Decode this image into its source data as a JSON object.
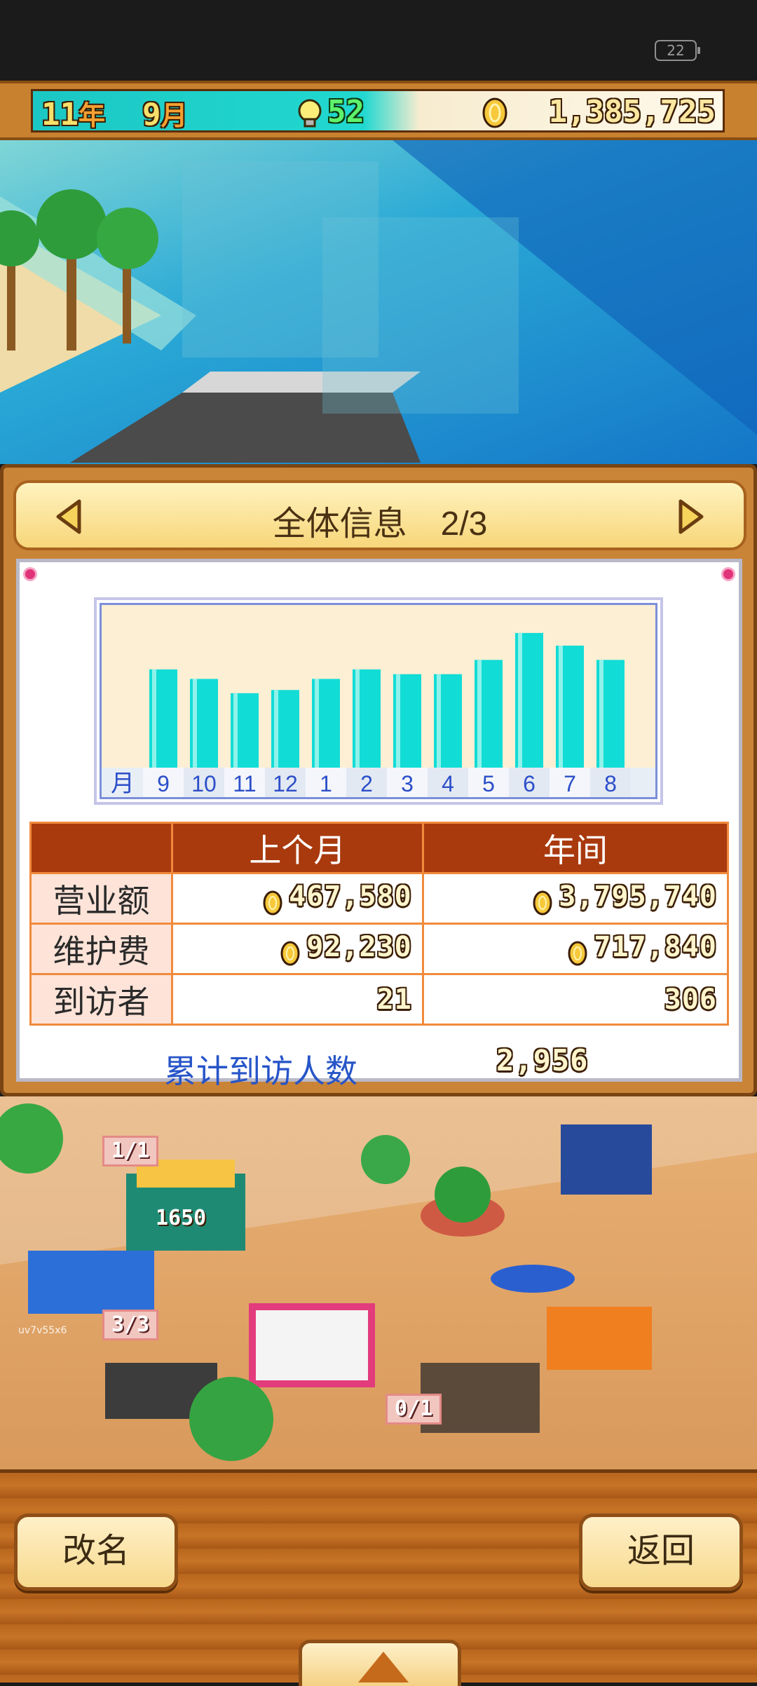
{
  "status_bar": {
    "battery": "22"
  },
  "top_bar": {
    "year": "11",
    "year_unit": "年",
    "month": "9",
    "month_unit": "月",
    "ideas": "52",
    "money": "1,385,725"
  },
  "panel": {
    "title": "全体信息　2/3",
    "chart_data": {
      "type": "bar",
      "x_unit_label": "月",
      "categories": [
        "9",
        "10",
        "11",
        "12",
        "1",
        "2",
        "3",
        "4",
        "5",
        "6",
        "7",
        "8"
      ],
      "values": [
        62,
        56,
        47,
        49,
        56,
        62,
        59,
        59,
        68,
        85,
        77,
        68
      ],
      "ylim": [
        0,
        100
      ],
      "colors": {
        "bar": "#12dcd6",
        "bar_highlight": "#8ff2ea",
        "bg": "#fdefd4",
        "axis_text": "#2c4fc9"
      }
    },
    "table": {
      "headers": [
        "",
        "上个月",
        "年间"
      ],
      "rows": [
        {
          "label": "营业额",
          "last_month": "467,580",
          "yearly": "3,795,740",
          "coin": true
        },
        {
          "label": "维护费",
          "last_month": "92,230",
          "yearly": "717,840",
          "coin": true
        },
        {
          "label": "到访者",
          "last_month": "21",
          "yearly": "306",
          "coin": false
        }
      ]
    },
    "cumulative_label": "累计到访人数",
    "cumulative_value": "2,956"
  },
  "scene": {
    "tags": [
      "1/1",
      "1650",
      "3/3",
      "0/1"
    ],
    "watermark": "uv7v55x6"
  },
  "buttons": {
    "rename": "改名",
    "back": "返回"
  }
}
